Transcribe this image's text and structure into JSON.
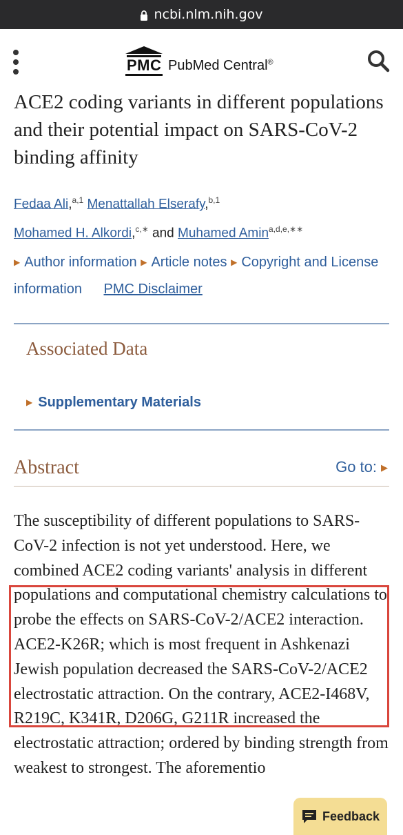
{
  "browser": {
    "url": "ncbi.nlm.nih.gov"
  },
  "header": {
    "logo_short": "PMC",
    "logo_full": "PubMed Central",
    "registered": "®"
  },
  "article": {
    "title": "ACE2 coding variants in different populations and their potential impact on SARS-CoV-2 binding affinity",
    "authors": [
      {
        "name": "Fedaa Ali",
        "sup": "a,1"
      },
      {
        "name": "Menattallah Elserafy",
        "sup": "b,1"
      },
      {
        "name": "Mohamed H. Alkordi",
        "sup": "c,∗"
      },
      {
        "name": "Muhamed Amin",
        "sup": "a,d,e,∗∗"
      }
    ],
    "and": "and",
    "links": {
      "author_info": "Author information",
      "article_notes": "Article notes",
      "copyright": "Copyright and License information",
      "disclaimer": "PMC Disclaimer"
    }
  },
  "associated_data": {
    "title": "Associated Data",
    "supplementary": "Supplementary Materials"
  },
  "abstract": {
    "title": "Abstract",
    "goto": "Go to:",
    "text": "The susceptibility of different populations to SARS-CoV-2 infection is not yet understood. Here, we combined ACE2 coding variants' analysis in different populations and computational chemistry calculations to probe the effects on SARS-CoV-2/ACE2 interaction. ACE2-K26R; which is most frequent in Ashkenazi Jewish population decreased the SARS-CoV-2/ACE2 electrostatic attraction. On the contrary, ACE2-I468V, R219C, K341R, D206G, G211R increased the electrostatic attraction; ordered by binding strength from weakest to strongest. The aforementio"
  },
  "feedback": {
    "label": "Feedback"
  },
  "colors": {
    "link": "#2e5e9c",
    "heading": "#8b5a3c",
    "accent": "#c0702a",
    "highlight": "#d9463c",
    "feedback_bg": "#f4dd94"
  }
}
